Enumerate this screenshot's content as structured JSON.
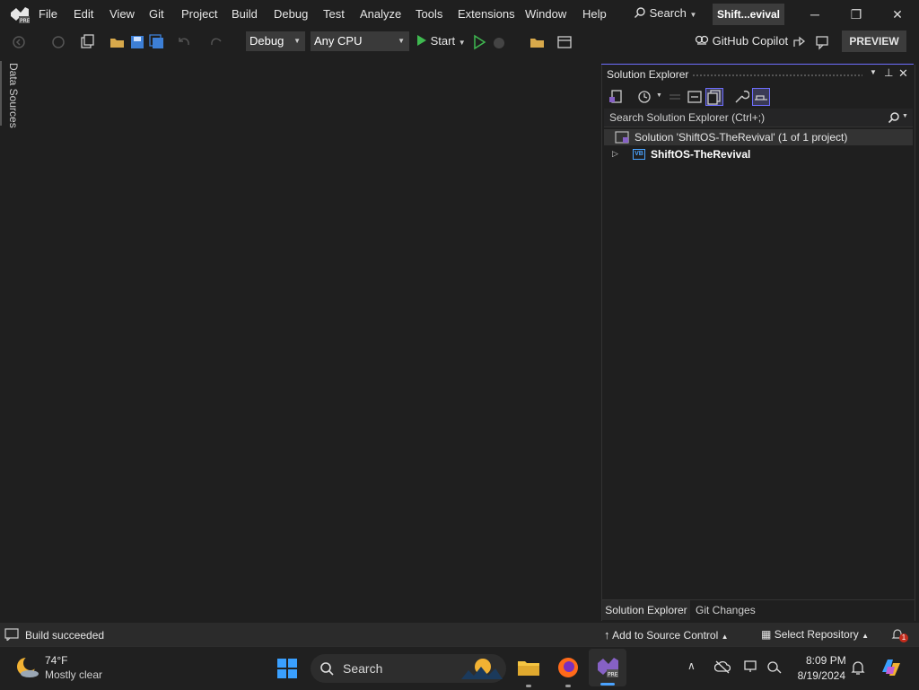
{
  "menubar": {
    "items": [
      "File",
      "Edit",
      "View",
      "Git",
      "Project",
      "Build",
      "Debug",
      "Test",
      "Analyze",
      "Tools",
      "Extensions",
      "Window",
      "Help"
    ],
    "search_label": "Search",
    "project_name": "Shift...evival"
  },
  "toolbar": {
    "config": "Debug",
    "platform": "Any CPU",
    "start_label": "Start",
    "copilot_label": "GitHub Copilot",
    "preview_label": "PREVIEW"
  },
  "left_strip": {
    "data_sources": "Data Sources"
  },
  "solution_explorer": {
    "title": "Solution Explorer",
    "search_placeholder": "Search Solution Explorer (Ctrl+;)",
    "solution_label": "Solution 'ShiftOS-TheRevival' (1 of 1 project)",
    "project_label": "ShiftOS-TheRevival",
    "project_badge": "VB",
    "tabs": [
      "Solution Explorer",
      "Git Changes"
    ]
  },
  "statusbar": {
    "status": "Build succeeded",
    "source_control": "Add to Source Control",
    "repository": "Select Repository",
    "notification_count": "1"
  },
  "taskbar": {
    "weather_temp": "74°F",
    "weather_desc": "Mostly clear",
    "search_label": "Search",
    "time": "8:09 PM",
    "date": "8/19/2024"
  },
  "colors": {
    "accent": "#6e6eff",
    "vs_purple": "#8661c5",
    "start_green": "#3fb950"
  }
}
